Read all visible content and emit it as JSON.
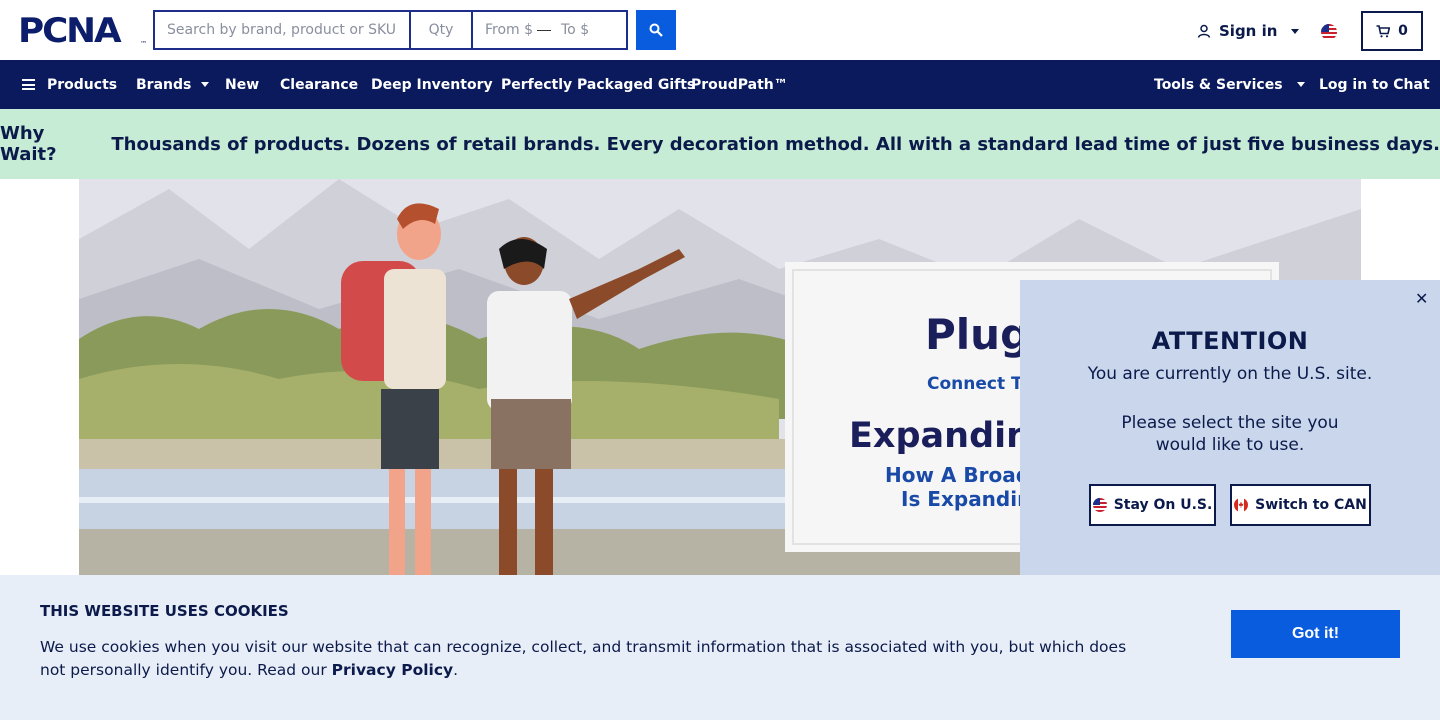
{
  "header": {
    "logo_text": "PCNA",
    "logo_tm": "™",
    "search_placeholder": "Search by brand, product or SKU",
    "qty_placeholder": "Qty",
    "from_placeholder": "From $",
    "to_placeholder": "To $",
    "signin_label": "Sign in",
    "cart_count": "0"
  },
  "nav": {
    "products": "Products",
    "brands": "Brands",
    "new": "New",
    "clearance": "Clearance",
    "deep_inventory": "Deep Inventory",
    "gifts": "Perfectly Packaged Gifts",
    "proudpath": "ProudPath™",
    "tools": "Tools & Services",
    "chat": "Log in to Chat"
  },
  "promo": {
    "lead": "Why Wait?",
    "text": " Thousands of products. Dozens of retail brands. Every decoration method. All with a standard lead time of just five business days."
  },
  "hero": {
    "brand": "Plugg",
    "tagline": "Connect To",
    "headline": "Expandin",
    "sub1": "How A Broad",
    "sub2": "Is Expandin"
  },
  "popup": {
    "close": "✕",
    "title": "ATTENTION",
    "line1": "You are currently on the U.S. site.",
    "line2": "Please select the site you",
    "line3": "would like to use.",
    "stay_label": "Stay On U.S.",
    "switch_label": "Switch to CAN"
  },
  "cookie": {
    "title": "THIS WEBSITE USES COOKIES",
    "text": "We use cookies when you visit our website that can recognize, collect, and transmit information that is associated with you, but which does not personally identify you. Read our ",
    "link": "Privacy Policy",
    "end": ".",
    "button": "Got it!"
  },
  "colors": {
    "navy": "#0a1a5c",
    "accent_blue": "#0a5cde",
    "promo_green": "#c6ecd5",
    "popup_bg": "#c9d6ec",
    "cookie_bg": "#e8eef8"
  }
}
